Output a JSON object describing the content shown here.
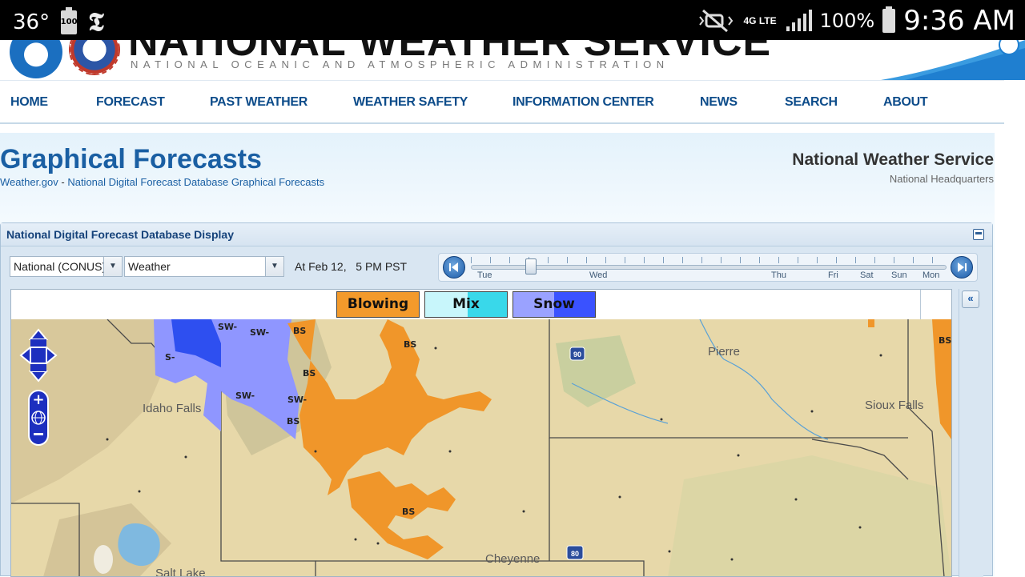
{
  "status_bar": {
    "temperature": "36°",
    "battery_small": "100",
    "battery_percent": "100%",
    "network": "4G LTE",
    "time": "9:36 AM"
  },
  "header": {
    "title": "NATIONAL WEATHER SERVICE",
    "subtitle": "NATIONAL OCEANIC AND ATMOSPHERIC ADMINISTRATION"
  },
  "nav": {
    "items": [
      "HOME",
      "FORECAST",
      "PAST WEATHER",
      "WEATHER SAFETY",
      "INFORMATION CENTER",
      "NEWS",
      "SEARCH",
      "ABOUT"
    ]
  },
  "page": {
    "title": "Graphical Forecasts",
    "breadcrumb_home": "Weather.gov",
    "breadcrumb_sep": " - ",
    "breadcrumb_current": "National Digital Forecast Database Graphical Forecasts",
    "office_title": "National Weather Service",
    "office_sub": "National Headquarters"
  },
  "panel": {
    "title": "National Digital Forecast Database Display",
    "region_value": "National (CONUS)",
    "element_value": "Weather",
    "time_label": "At Feb 12,   5 PM PST",
    "timeline_days": [
      "Tue",
      "Wed",
      "Thu",
      "Fri",
      "Sat",
      "Sun",
      "Mon"
    ],
    "collapse_symbol": "«"
  },
  "legend": {
    "items": [
      {
        "label": "Blowing",
        "color": "#f39a2b"
      },
      {
        "label": "Mix",
        "color": "#5be3ef"
      },
      {
        "label": "Snow",
        "color": "#7f8cff"
      }
    ]
  },
  "map": {
    "cities": [
      "Pierre",
      "Idaho Falls",
      "Sioux Falls",
      "Cheyenne",
      "Salt Lake"
    ],
    "highways": [
      "90",
      "80"
    ],
    "codes": {
      "bs": "BS",
      "sw": "SW-",
      "s": "S-"
    },
    "colors": {
      "terrain": "#e6d7a8",
      "blowing": "#f0962a",
      "snow_light": "#8f96ff",
      "snow_heavy": "#2e4ff0",
      "water": "#7fb9e0",
      "border": "#444444"
    }
  }
}
